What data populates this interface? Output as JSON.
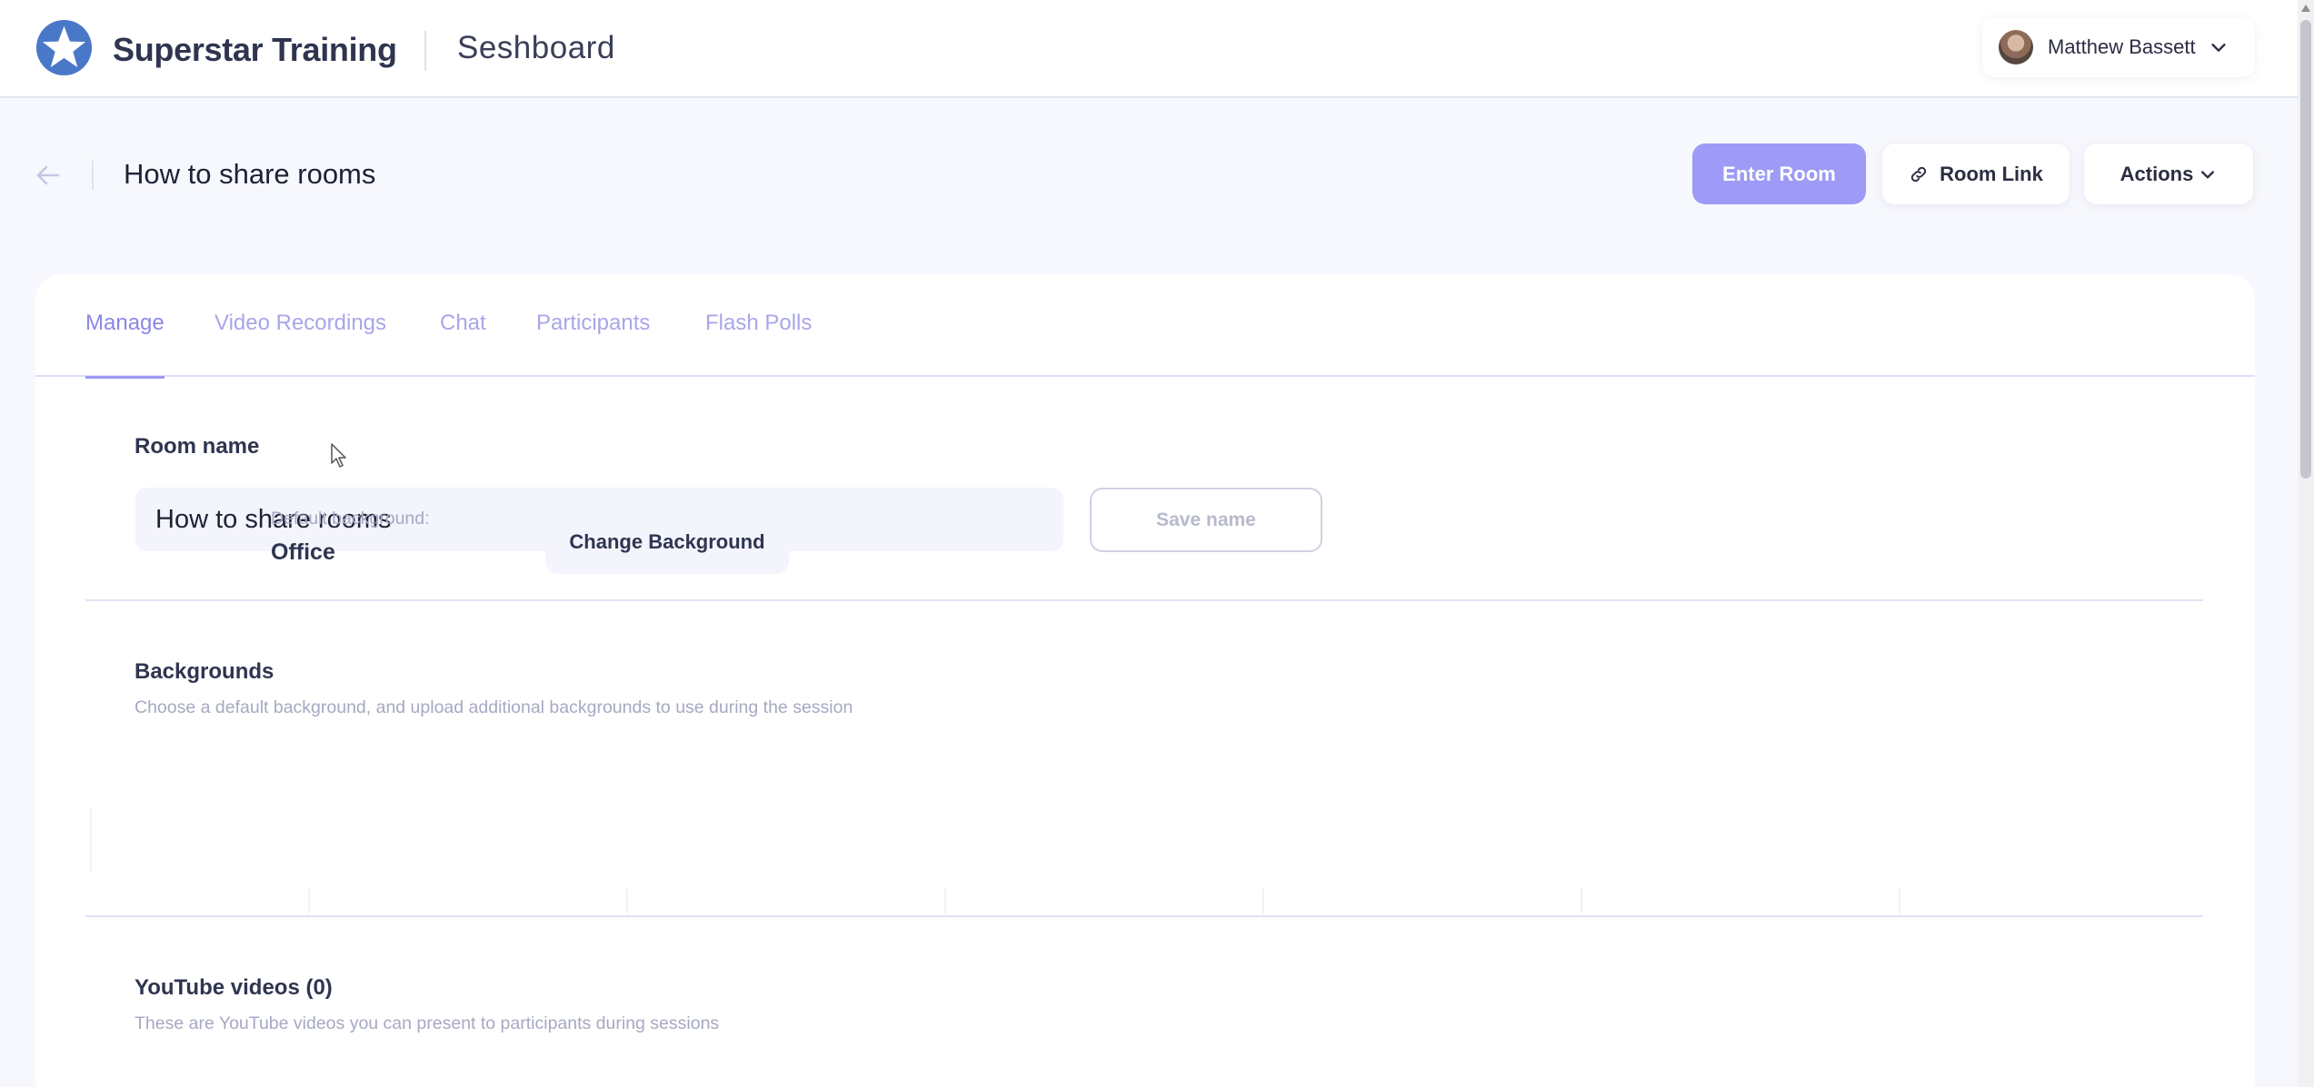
{
  "header": {
    "brand": "Superstar Training",
    "product": "Seshboard",
    "user_name": "Matthew Bassett",
    "logo_icon": "star-logo-icon",
    "accent": "#4a78c9"
  },
  "title_row": {
    "title": "How to share rooms",
    "enter_label": "Enter Room",
    "room_link_label": "Room Link",
    "actions_label": "Actions"
  },
  "tabs": [
    {
      "label": "Manage",
      "active": true
    },
    {
      "label": "Video Recordings",
      "active": false
    },
    {
      "label": "Chat",
      "active": false
    },
    {
      "label": "Participants",
      "active": false
    },
    {
      "label": "Flash Polls",
      "active": false
    }
  ],
  "room_name": {
    "label": "Room name",
    "value": "How to share rooms",
    "save_label": "Save name"
  },
  "backgrounds": {
    "title": "Backgrounds",
    "subtitle": "Choose a default background, and upload additional backgrounds to use during the session",
    "default_label": "Default background:",
    "default_value": "Office",
    "change_label": "Change Background"
  },
  "youtube": {
    "title": "YouTube videos (0)",
    "subtitle": "These are YouTube videos you can present to participants during sessions"
  },
  "colors": {
    "primary": "#9d9bf5",
    "tab_active": "#8b87e6",
    "tab_inactive": "#a9a6e8"
  }
}
